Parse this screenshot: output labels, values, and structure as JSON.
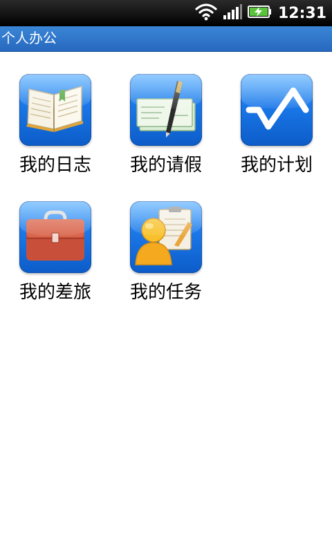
{
  "status_bar": {
    "time": "12:31",
    "icons": [
      "wifi-icon",
      "signal-bars-icon",
      "battery-charging-icon"
    ]
  },
  "title_bar": {
    "title": "个人办公"
  },
  "grid": {
    "items": [
      {
        "label": "我的日志",
        "icon": "open-book-icon"
      },
      {
        "label": "我的请假",
        "icon": "pen-on-cheque-icon"
      },
      {
        "label": "我的计划",
        "icon": "check-wave-icon"
      },
      {
        "label": "我的差旅",
        "icon": "briefcase-icon"
      },
      {
        "label": "我的任务",
        "icon": "person-clipboard-icon"
      }
    ]
  },
  "colors": {
    "title_bar": "#2a72cf",
    "icon_tile": "#1a77e8",
    "status_bar": "#000000"
  }
}
